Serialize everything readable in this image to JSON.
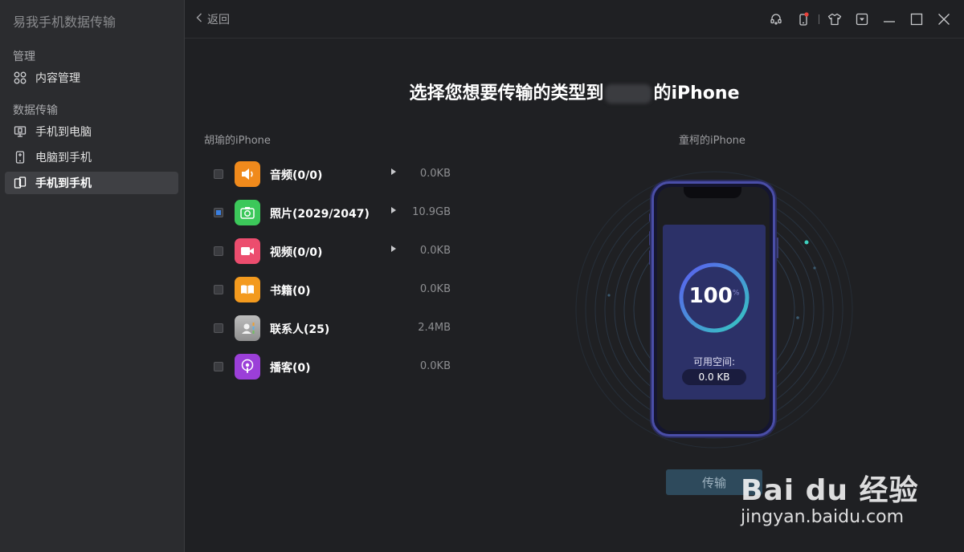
{
  "app": {
    "title": "易我手机数据传输"
  },
  "sidebar": {
    "section_manage": "管理",
    "content_manage": "内容管理",
    "section_transfer": "数据传输",
    "items": [
      {
        "label": "手机到电脑",
        "icon": "phone-to-pc-icon"
      },
      {
        "label": "电脑到手机",
        "icon": "pc-to-phone-icon"
      },
      {
        "label": "手机到手机",
        "icon": "phone-to-phone-icon",
        "active": true
      }
    ]
  },
  "topbar": {
    "back_label": "返回"
  },
  "main": {
    "title_prefix": "选择您想要传输的类型到",
    "title_suffix": "的iPhone",
    "source_device": "胡瑜的iPhone",
    "target_device": "童柯的iPhone"
  },
  "categories": [
    {
      "label": "音频(0/0)",
      "size": "0.0KB",
      "checked": false,
      "expandable": true,
      "icon": "audio-icon",
      "color": "#f08a1c"
    },
    {
      "label": "照片(2029/2047)",
      "size": "10.9GB",
      "checked": true,
      "expandable": true,
      "icon": "camera-icon",
      "color": "#3cc85a"
    },
    {
      "label": "视频(0/0)",
      "size": "0.0KB",
      "checked": false,
      "expandable": true,
      "icon": "video-icon",
      "color": "#ec4d6e"
    },
    {
      "label": "书籍(0)",
      "size": "0.0KB",
      "checked": false,
      "expandable": false,
      "icon": "book-icon",
      "color": "#f39a1e"
    },
    {
      "label": "联系人(25)",
      "size": "2.4MB",
      "checked": false,
      "expandable": false,
      "icon": "contacts-icon",
      "color": "#a8a8a8"
    },
    {
      "label": "播客(0)",
      "size": "0.0KB",
      "checked": false,
      "expandable": false,
      "icon": "podcast-icon",
      "color": "#9b3fd8"
    }
  ],
  "phone": {
    "percent": "100",
    "percent_sign": "%",
    "available_label": "可用空间:",
    "available_value": "0.0 KB"
  },
  "transfer_button": "传输",
  "watermark": {
    "brand": "Bai du 经验",
    "url": "jingyan.baidu.com"
  }
}
